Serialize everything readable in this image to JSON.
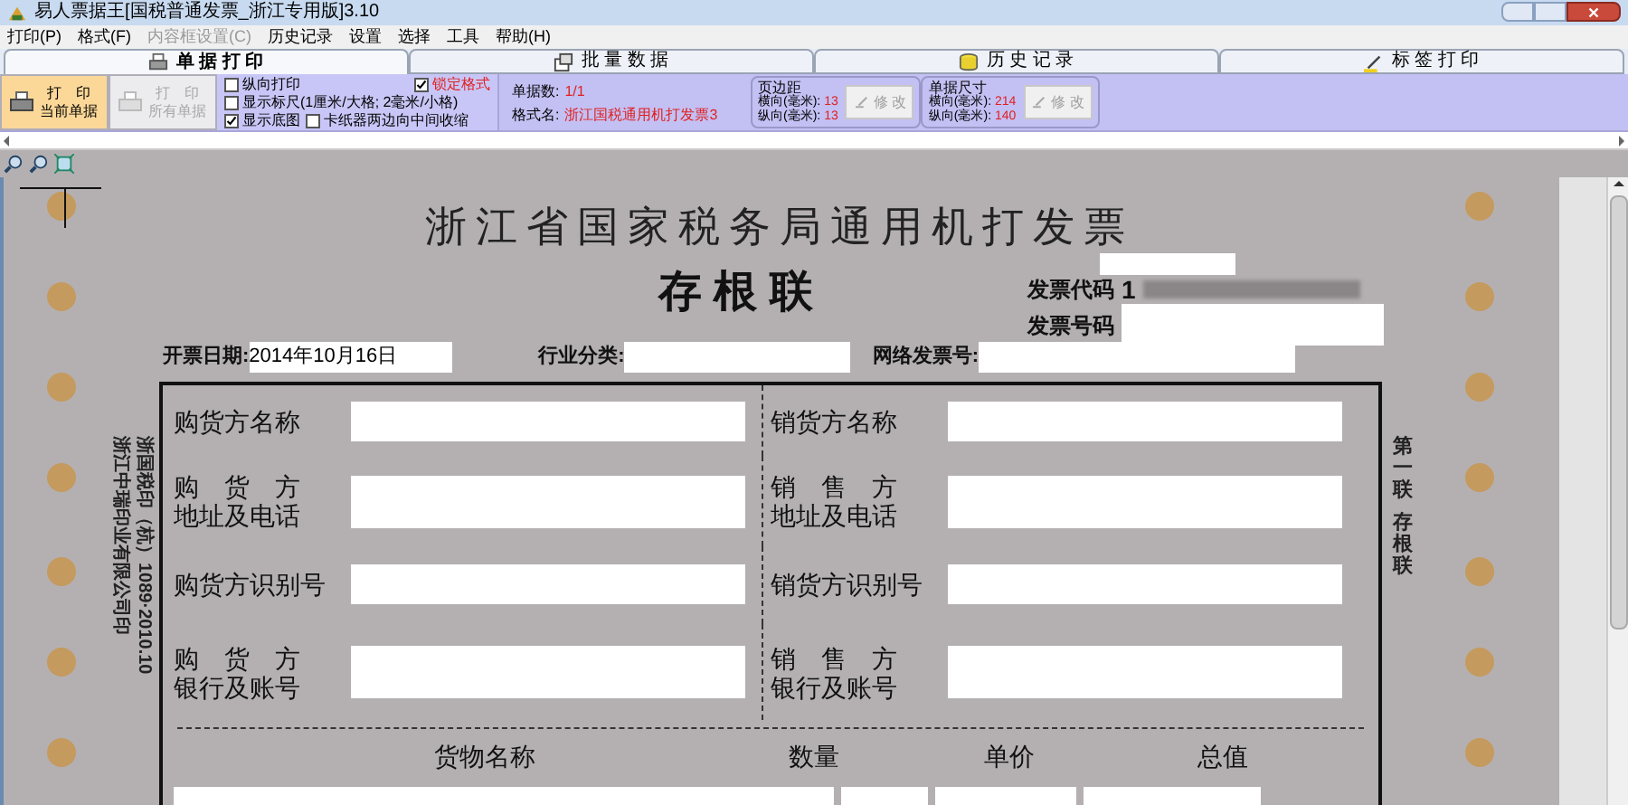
{
  "window": {
    "title": "易人票据王[国税普通发票_浙江专用版]3.10"
  },
  "menu": [
    {
      "label": "打印(P)",
      "disabled": false
    },
    {
      "label": "格式(F)",
      "disabled": false
    },
    {
      "label": "内容框设置(C)",
      "disabled": true
    },
    {
      "label": "历史记录",
      "disabled": false
    },
    {
      "label": "设置",
      "disabled": false
    },
    {
      "label": "选择",
      "disabled": false
    },
    {
      "label": "工具",
      "disabled": false
    },
    {
      "label": "帮助(H)",
      "disabled": false
    }
  ],
  "tabs": [
    {
      "label": "单 据 打 印",
      "selected": true
    },
    {
      "label": "批 量 数 据",
      "selected": false
    },
    {
      "label": "历 史 记 录",
      "selected": false
    },
    {
      "label": "标 签 打 印",
      "selected": false
    }
  ],
  "print_buttons": [
    {
      "top": "打　印",
      "bottom": "当前单据",
      "disabled": false
    },
    {
      "top": "打　印",
      "bottom": "所有单据",
      "disabled": true
    }
  ],
  "options": [
    {
      "label": "纵向打印",
      "checked": false,
      "kind": "plain"
    },
    {
      "label": "锁定格式",
      "checked": true,
      "kind": "warning"
    },
    {
      "label": "显示标尺(1厘米/大格; 2毫米/小格)",
      "checked": false,
      "kind": "plain"
    },
    {
      "label": "显示底图",
      "checked": true,
      "kind": "plain"
    },
    {
      "label": "卡纸器两边向中间收缩",
      "checked": false,
      "kind": "plain"
    }
  ],
  "info": [
    {
      "label": "单据数:",
      "value": "1/1"
    },
    {
      "label": "格式名:",
      "value": "浙江国税通用机打发票3"
    }
  ],
  "groups": [
    {
      "title": "页边距",
      "rows": [
        {
          "label": "横向(毫米):",
          "value": "13"
        },
        {
          "label": "纵向(毫米):",
          "value": "13"
        }
      ],
      "button": {
        "label": "修 改",
        "disabled": true
      }
    },
    {
      "title": "单据尺寸",
      "rows": [
        {
          "label": "横向(毫米):",
          "value": "214"
        },
        {
          "label": "纵向(毫米):",
          "value": "140"
        }
      ],
      "button": {
        "label": "修 改",
        "disabled": true
      }
    }
  ],
  "invoice": {
    "title": "浙江省国家税务局通用机打发票",
    "subtitle": "存 根 联",
    "code_label": "发票代码",
    "code_value": "1",
    "number_label": "发票号码",
    "header_fields": [
      {
        "label": "开票日期:",
        "value": "2014年10月16日"
      },
      {
        "label": "行业分类:"
      },
      {
        "label": "网络发票号:"
      }
    ],
    "party_rows": [
      {
        "buyer": [
          "购货方名称"
        ],
        "seller": [
          "销货方名称"
        ]
      },
      {
        "buyer": [
          "购　货　方",
          "地址及电话"
        ],
        "seller": [
          "销　售　方",
          "地址及电话"
        ]
      },
      {
        "buyer": [
          "购货方识别号"
        ],
        "seller": [
          "销货方识别号"
        ]
      },
      {
        "buyer": [
          "购　货　方",
          "银行及账号"
        ],
        "seller": [
          "销　售　方",
          "银行及账号"
        ]
      }
    ],
    "goods_columns": [
      "货物名称",
      "数量",
      "单价",
      "总值"
    ],
    "side_text": [
      "第一联",
      "存根联"
    ],
    "print_notes": [
      "浙江中瑞印业有限公司印",
      "浙国税印（杭）1089·2010.10"
    ]
  }
}
